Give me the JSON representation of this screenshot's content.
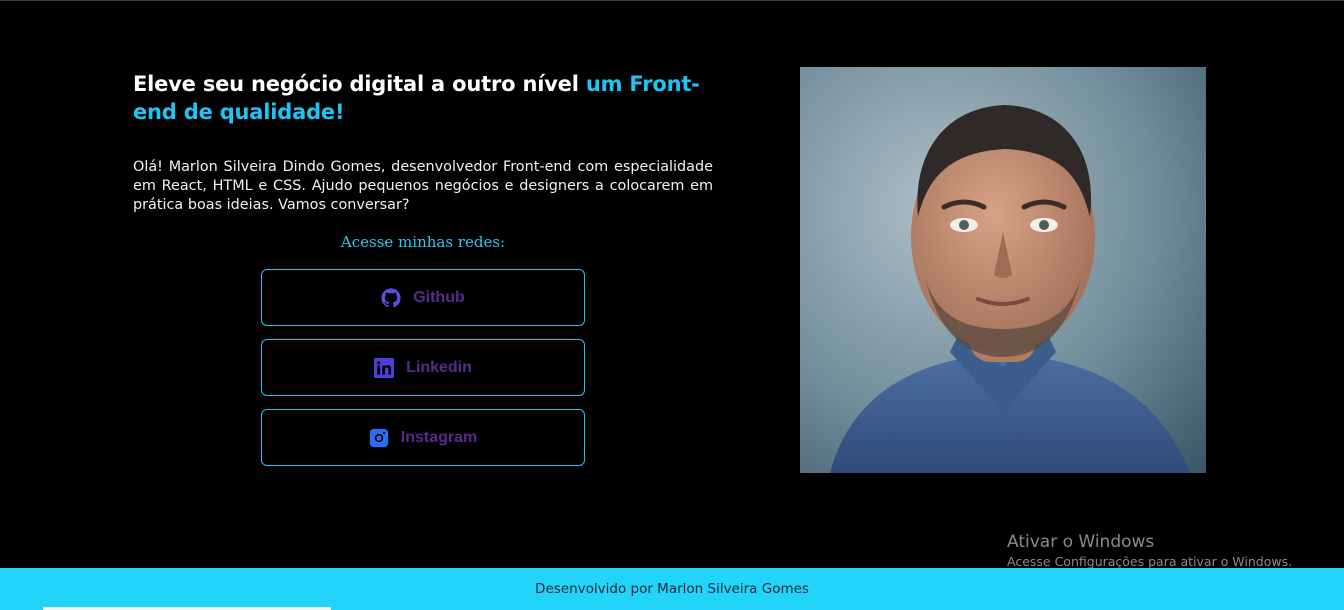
{
  "hero": {
    "headline_main": "Eleve seu negócio digital a outro nível ",
    "headline_accent": "um Front-end de qualidade!",
    "intro": "Olá! Marlon Silveira Dindo Gomes, desenvolvedor Front-end com especialidade em React, HTML e CSS. Ajudo pequenos negócios e designers a colocarem em prática boas ideias. Vamos conversar?"
  },
  "social": {
    "title": "Acesse minhas redes:",
    "links": [
      {
        "label": "Github",
        "icon": "github-icon",
        "icon_color": "#5b4de6"
      },
      {
        "label": "Linkedin",
        "icon": "linkedin-icon",
        "icon_color": "#4b3fd8"
      },
      {
        "label": "Instagram",
        "icon": "instagram-icon",
        "icon_color": "#2f6cf5"
      }
    ]
  },
  "portrait": {
    "alt": ""
  },
  "windows_watermark": {
    "title": "Ativar o Windows",
    "subtitle": "Acesse Configurações para ativar o Windows."
  },
  "footer": {
    "text": "Desenvolvido por Marlon Silveira Gomes"
  },
  "colors": {
    "background": "#000000",
    "accent": "#1ec4f2",
    "button_label": "#5a2a8a",
    "footer_bg": "#22d3fa"
  }
}
